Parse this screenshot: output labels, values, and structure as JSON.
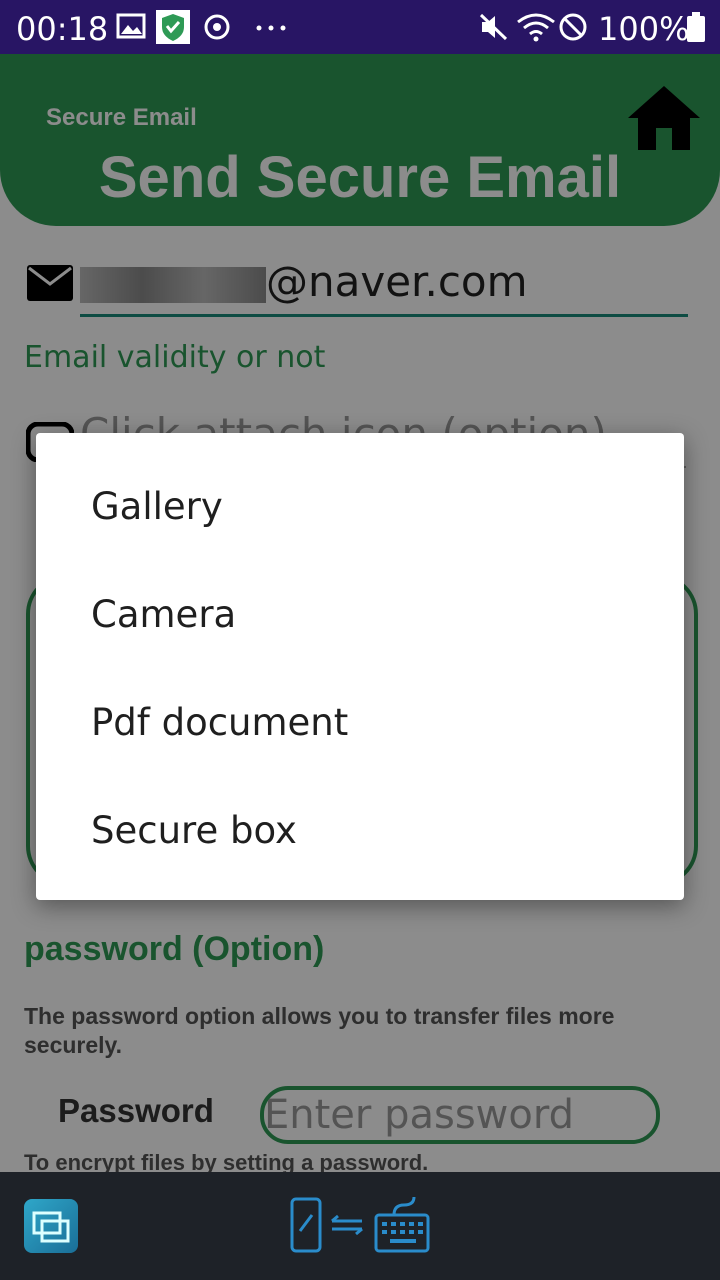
{
  "status_bar": {
    "time": "00:18",
    "battery_text": "100%",
    "icons": [
      "image-icon",
      "shield-app-icon",
      "sync-icon",
      "more-icon",
      "mute-vibrate-icon",
      "wifi-icon",
      "do-not-disturb-icon",
      "battery-icon"
    ]
  },
  "header": {
    "subtitle": "Secure Email",
    "title": "Send Secure Email",
    "home_icon": "home-icon"
  },
  "email": {
    "icon": "mail-icon",
    "value_visible": "@naver.com"
  },
  "validity_text": "Email validity or not",
  "attach": {
    "icon": "attach-icon",
    "placeholder": "Click attach icon (option)"
  },
  "password_section": {
    "heading": "password (Option)",
    "description": "The password option allows you to transfer files more securely.",
    "label": "Password",
    "input_placeholder": "Enter password",
    "hint": "To encrypt files by setting a password."
  },
  "dialog": {
    "items": [
      {
        "label": "Gallery"
      },
      {
        "label": "Camera"
      },
      {
        "label": "Pdf document"
      },
      {
        "label": "Secure box"
      }
    ]
  },
  "bottom_bar": {
    "icons": [
      "app-switch-icon",
      "keyboard-switch-icon"
    ]
  },
  "colors": {
    "accent_green": "#2e9a55",
    "status_bar": "#281564",
    "bottom_bar": "#1e2228"
  }
}
